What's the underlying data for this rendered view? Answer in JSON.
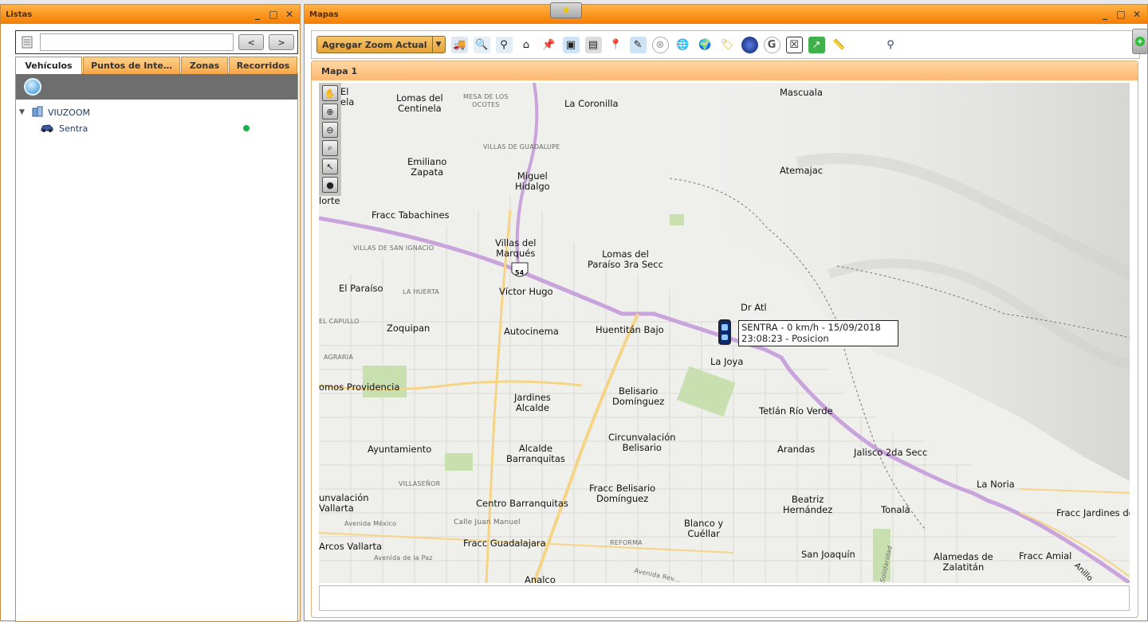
{
  "listas": {
    "title": "Listas",
    "search": {
      "value": "",
      "prev_label": "<",
      "next_label": ">"
    },
    "tabs": [
      {
        "label": "Vehículos",
        "active": true
      },
      {
        "label": "Puntos de Inte…",
        "active": false
      },
      {
        "label": "Zonas",
        "active": false
      },
      {
        "label": "Recorridos",
        "active": false
      }
    ],
    "tree": {
      "group": "VIUZOOM",
      "vehicle": "Sentra",
      "vehicle_status_color": "#19b24a"
    }
  },
  "mapas": {
    "title": "Mapas",
    "zoom_select": "Agregar Zoom Actual",
    "map_tab": "Mapa 1",
    "toolbar_icons": [
      "vehicle-list-icon",
      "vehicle-search-icon",
      "binoculars-icon",
      "home-icon",
      "pushpin-icon",
      "map-window-icon",
      "monitor-icon",
      "pin-group-icon",
      "map-edit-icon",
      "clear-icon",
      "globe-remove-icon",
      "globe-icon",
      "tag-icon",
      "earth-icon",
      "google-icon",
      "no-map-icon",
      "export-icon",
      "ruler-icon",
      "location-pin-icon"
    ],
    "tooltip": {
      "line1": "SENTRA - 0 km/h - 15/09/2018",
      "line2": "23:08:23 - Posicion"
    },
    "places": {
      "el_vela": "El\nela",
      "lomas_centinela": "Lomas del\nCentinela",
      "mesa_ocotes": "MESA DE LOS\nOCOTES",
      "la_coronilla": "La Coronilla",
      "mascuala": "Mascuala",
      "villas_guadalupe": "VILLAS DE GUADALUPE",
      "emiliano_zapata": "Emiliano\nZapata",
      "miguel_hidalgo": "Miguel\nHidalgo",
      "atemajac": "Atemajac",
      "norte": "lorte",
      "fracc_tabachines": "Fracc Tabachines",
      "villas_marques": "Villas del\nMarqués",
      "villas_san_ignacio": "VILLAS DE SAN IGNACIO",
      "lomas_paraiso": "Lomas del\nParaíso 3ra Secc",
      "route_54": "54",
      "el_paraiso": "El Paraíso",
      "la_huerta": "LA HUERTA",
      "victor_hugo": "Víctor Hugo",
      "dr_atl": "Dr Atl",
      "el_capullo": "EL CAPULLO",
      "zoquipan": "Zoquipan",
      "autocinema": "Autocinema",
      "huentitan_bajo": "Huentitán Bajo",
      "agraria": "AGRARIA",
      "la_joya": "La Joya",
      "lomas_providencia": "omos Providencia",
      "jardines_alcalde": "Jardines\nAlcalde",
      "belisario_dominguez": "Belisario\nDomínguez",
      "tetlan_rio_verde": "Tetlán Río Verde",
      "ayuntamiento": "Ayuntamiento",
      "alcalde_barranquitas": "Alcalde\nBarranquitas",
      "circunvalacion_belisario": "Circunvalación\nBelisario",
      "arandas": "Arandas",
      "jalisco_2da": "Jalisco 2da Secc",
      "villasenor": "VILLASEÑOR",
      "la_noria": "La Noria",
      "circ_vallarta": "unvalación\nVallarta",
      "fracc_belisario": "Fracc Belisario\nDomínguez",
      "centro_barranquitas": "Centro Barranquitas",
      "beatriz_hernandez": "Beatriz\nHernández",
      "tonala": "Tonalá",
      "fracc_jardines": "Fracc Jardines del",
      "avenida_mexico": "Avenida México",
      "calle_juan_manuel": "Calle Juan Manuel",
      "blanco_cuellar": "Blanco y\nCuéllar",
      "arcos_vallarta": "Arcos Vallarta",
      "fracc_guadalajara": "Fracc Guadalajara",
      "reforma": "REFORMA",
      "san_joaquin": "San Joaquín",
      "alamedas_zalatitan": "Alamedas de\nZalatitán",
      "fracc_amial": "Fracc Amial",
      "avenida_la_paz": "Avenida de la Paz",
      "analco": "Analco",
      "avenida_revolucion": "Avenida Rev...",
      "solidaridad": "Solidaridad",
      "anillo": "Anillo"
    }
  }
}
